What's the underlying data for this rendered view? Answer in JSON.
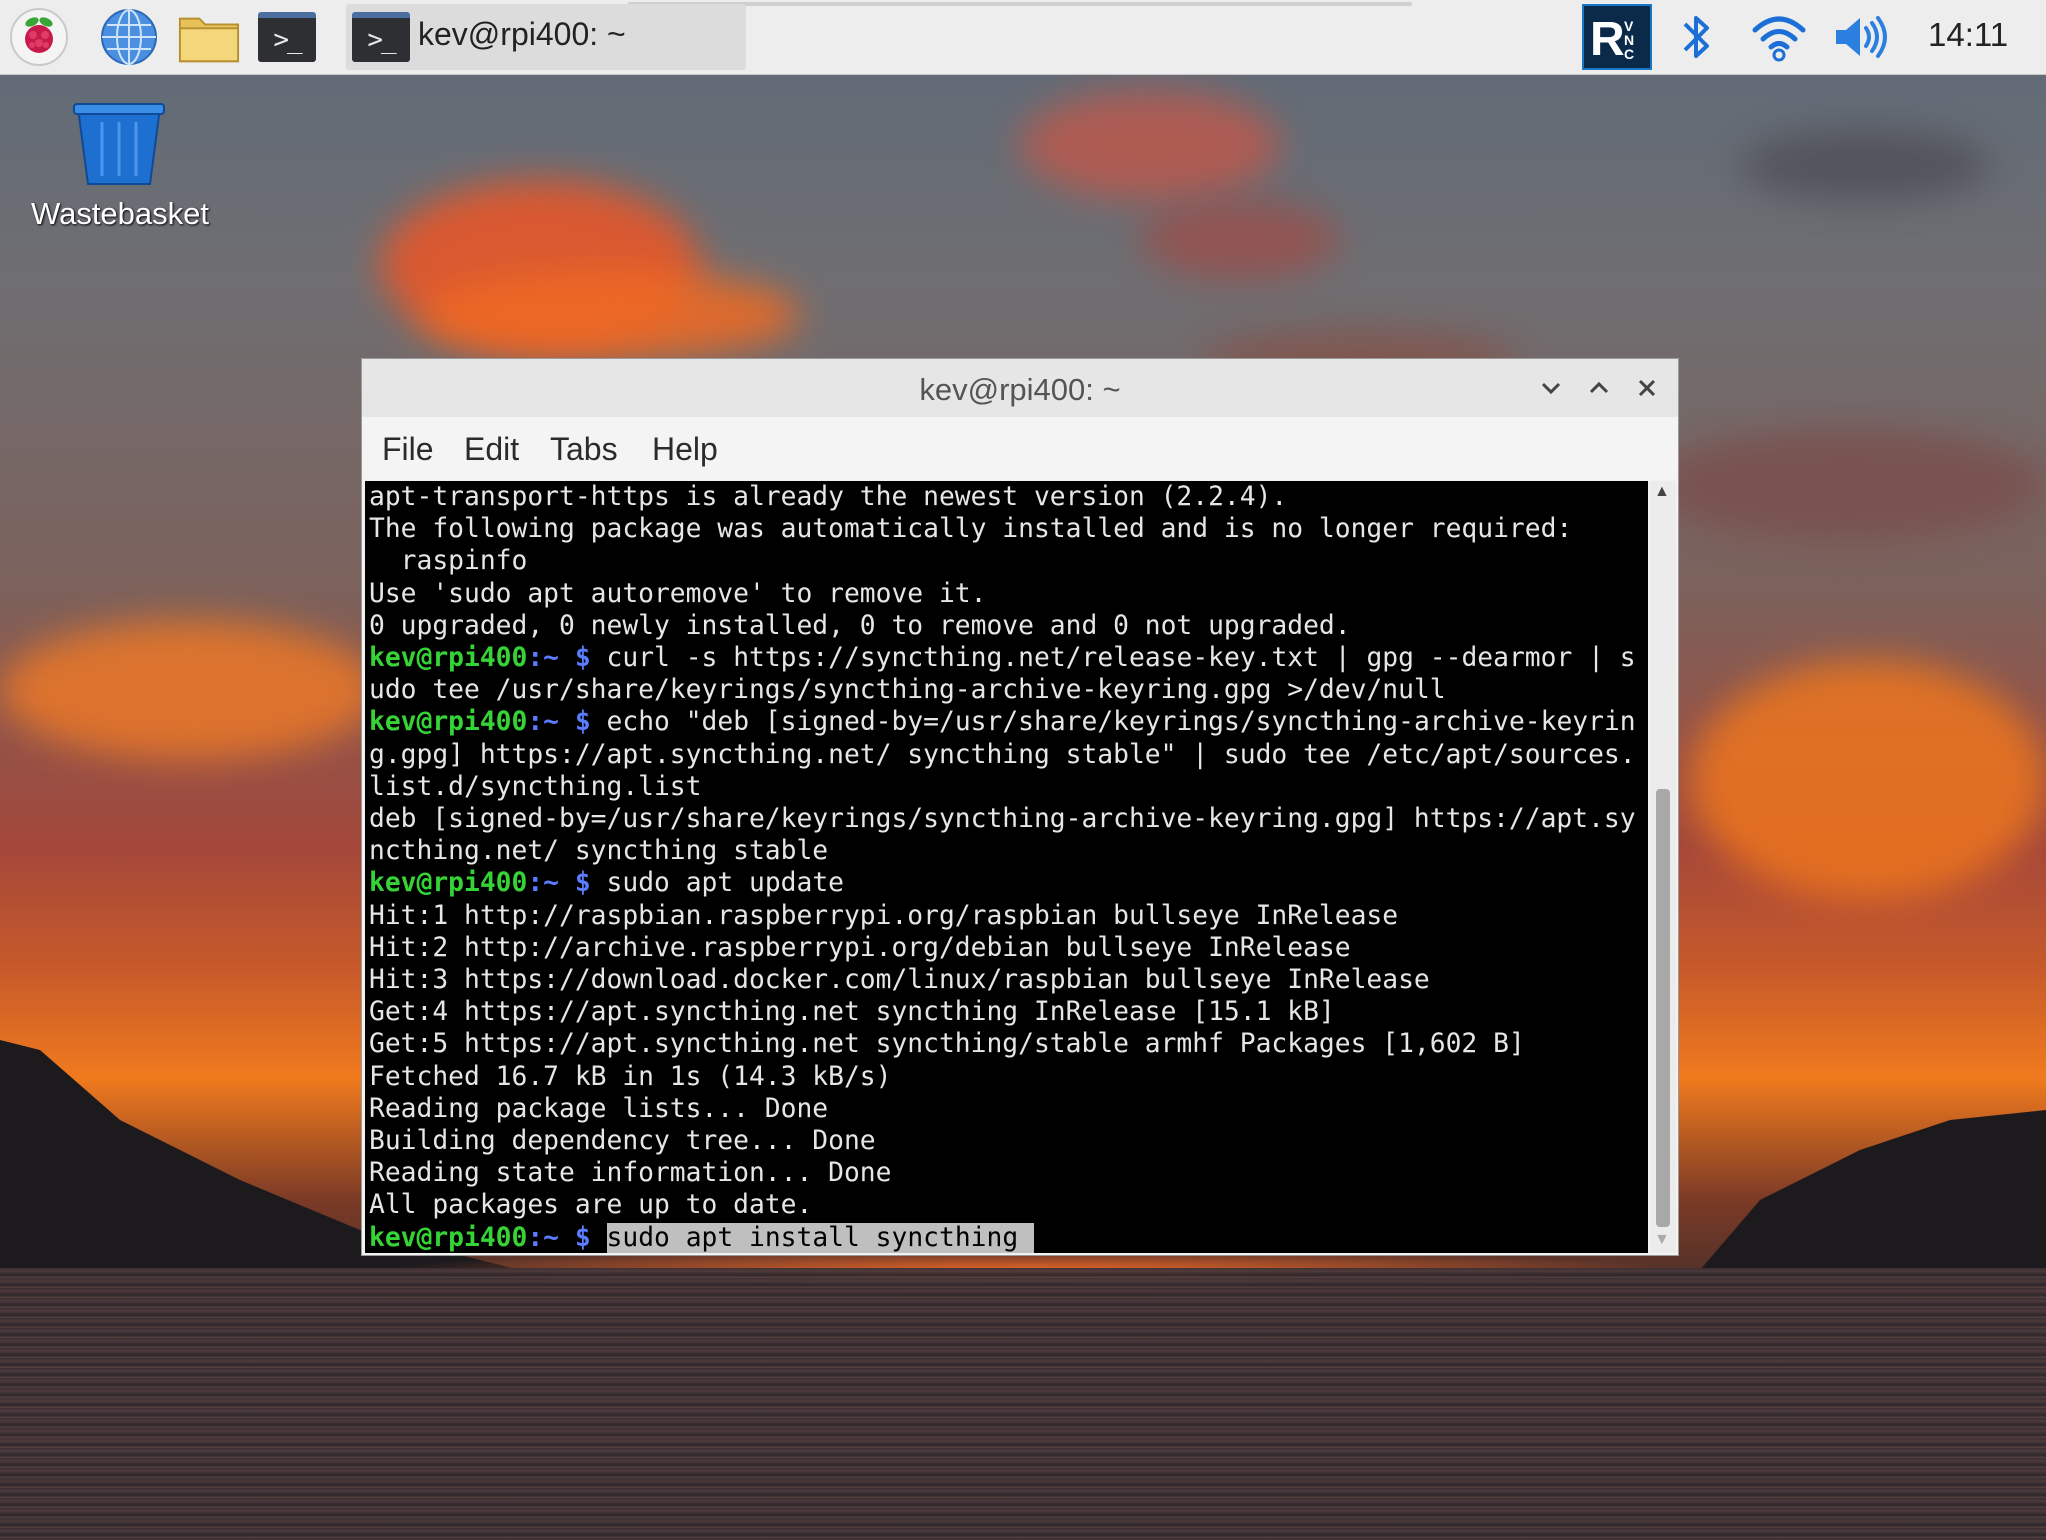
{
  "taskbar": {
    "menu_icon": "raspberry-pi-logo",
    "browser_icon": "globe-icon",
    "files_icon": "folder-icon",
    "terminal_icon": "terminal-icon",
    "terminal_glyph": ">_",
    "task_glyph": ">_",
    "task_title": "kev@rpi400: ~",
    "tray": {
      "vnc_icon": "vnc-icon",
      "bluetooth_icon": "bluetooth-icon",
      "wifi_icon": "wifi-icon",
      "volume_icon": "volume-icon"
    },
    "clock": "14:11"
  },
  "desktop": {
    "icons": [
      {
        "label": "Wastebasket",
        "icon": "trash-icon"
      }
    ]
  },
  "window": {
    "title": "kev@rpi400: ~",
    "controls": [
      "minimize",
      "maximize",
      "close"
    ],
    "menu": [
      "File",
      "Edit",
      "Tabs",
      "Help"
    ],
    "terminal": {
      "prompt_user": "kev@rpi400",
      "prompt_path": ":~",
      "prompt_symbol": "$",
      "lines": [
        {
          "type": "out",
          "text": "apt-transport-https is already the newest version (2.2.4)."
        },
        {
          "type": "out",
          "text": "The following package was automatically installed and is no longer required:"
        },
        {
          "type": "out",
          "text": "  raspinfo"
        },
        {
          "type": "out",
          "text": "Use 'sudo apt autoremove' to remove it."
        },
        {
          "type": "out",
          "text": "0 upgraded, 0 newly installed, 0 to remove and 0 not upgraded."
        },
        {
          "type": "cmd",
          "text": "curl -s https://syncthing.net/release-key.txt | gpg --dearmor | s"
        },
        {
          "type": "out",
          "text": "udo tee /usr/share/keyrings/syncthing-archive-keyring.gpg >/dev/null"
        },
        {
          "type": "cmd",
          "text": "echo \"deb [signed-by=/usr/share/keyrings/syncthing-archive-keyrin"
        },
        {
          "type": "out",
          "text": "g.gpg] https://apt.syncthing.net/ syncthing stable\" | sudo tee /etc/apt/sources."
        },
        {
          "type": "out",
          "text": "list.d/syncthing.list"
        },
        {
          "type": "out",
          "text": "deb [signed-by=/usr/share/keyrings/syncthing-archive-keyring.gpg] https://apt.sy"
        },
        {
          "type": "out",
          "text": "ncthing.net/ syncthing stable"
        },
        {
          "type": "cmd",
          "text": "sudo apt update"
        },
        {
          "type": "out",
          "text": "Hit:1 http://raspbian.raspberrypi.org/raspbian bullseye InRelease"
        },
        {
          "type": "out",
          "text": "Hit:2 http://archive.raspberrypi.org/debian bullseye InRelease"
        },
        {
          "type": "out",
          "text": "Hit:3 https://download.docker.com/linux/raspbian bullseye InRelease"
        },
        {
          "type": "out",
          "text": "Get:4 https://apt.syncthing.net syncthing InRelease [15.1 kB]"
        },
        {
          "type": "out",
          "text": "Get:5 https://apt.syncthing.net syncthing/stable armhf Packages [1,602 B]"
        },
        {
          "type": "out",
          "text": "Fetched 16.7 kB in 1s (14.3 kB/s)"
        },
        {
          "type": "out",
          "text": "Reading package lists... Done"
        },
        {
          "type": "out",
          "text": "Building dependency tree... Done"
        },
        {
          "type": "out",
          "text": "Reading state information... Done"
        },
        {
          "type": "out",
          "text": "All packages are up to date."
        },
        {
          "type": "current",
          "text": "sudo apt install syncthing "
        }
      ]
    }
  },
  "colors": {
    "prompt_user": "#36d336",
    "prompt_path": "#5b7cff",
    "terminal_bg": "#000000",
    "terminal_fg": "#e6e6e6",
    "selection_bg": "#bfbfbf"
  }
}
